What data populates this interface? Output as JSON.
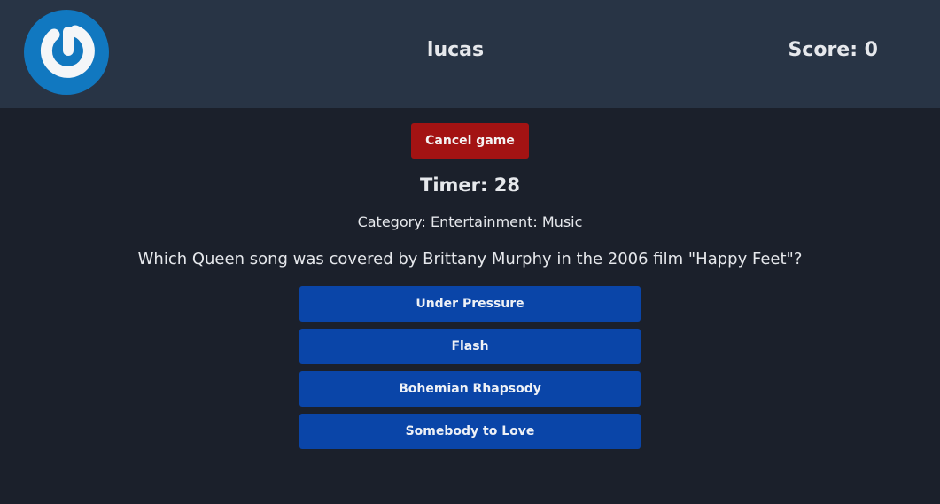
{
  "header": {
    "logo": "power-logo",
    "username": "lucas",
    "score": "Score: 0"
  },
  "main": {
    "cancel_label": "Cancel game",
    "timer": "Timer: 28",
    "category": "Category: Entertainment: Music",
    "question": "Which Queen song was covered by Brittany Murphy in the 2006 film \"Happy Feet\"?",
    "answers": [
      "Under Pressure",
      "Flash",
      "Bohemian Rhapsody",
      "Somebody to Love"
    ]
  },
  "colors": {
    "header_bg": "#283445",
    "page_bg": "#1b202b",
    "cancel": "#a31313",
    "answer": "#0a45a8",
    "logo": "#1178c0"
  }
}
